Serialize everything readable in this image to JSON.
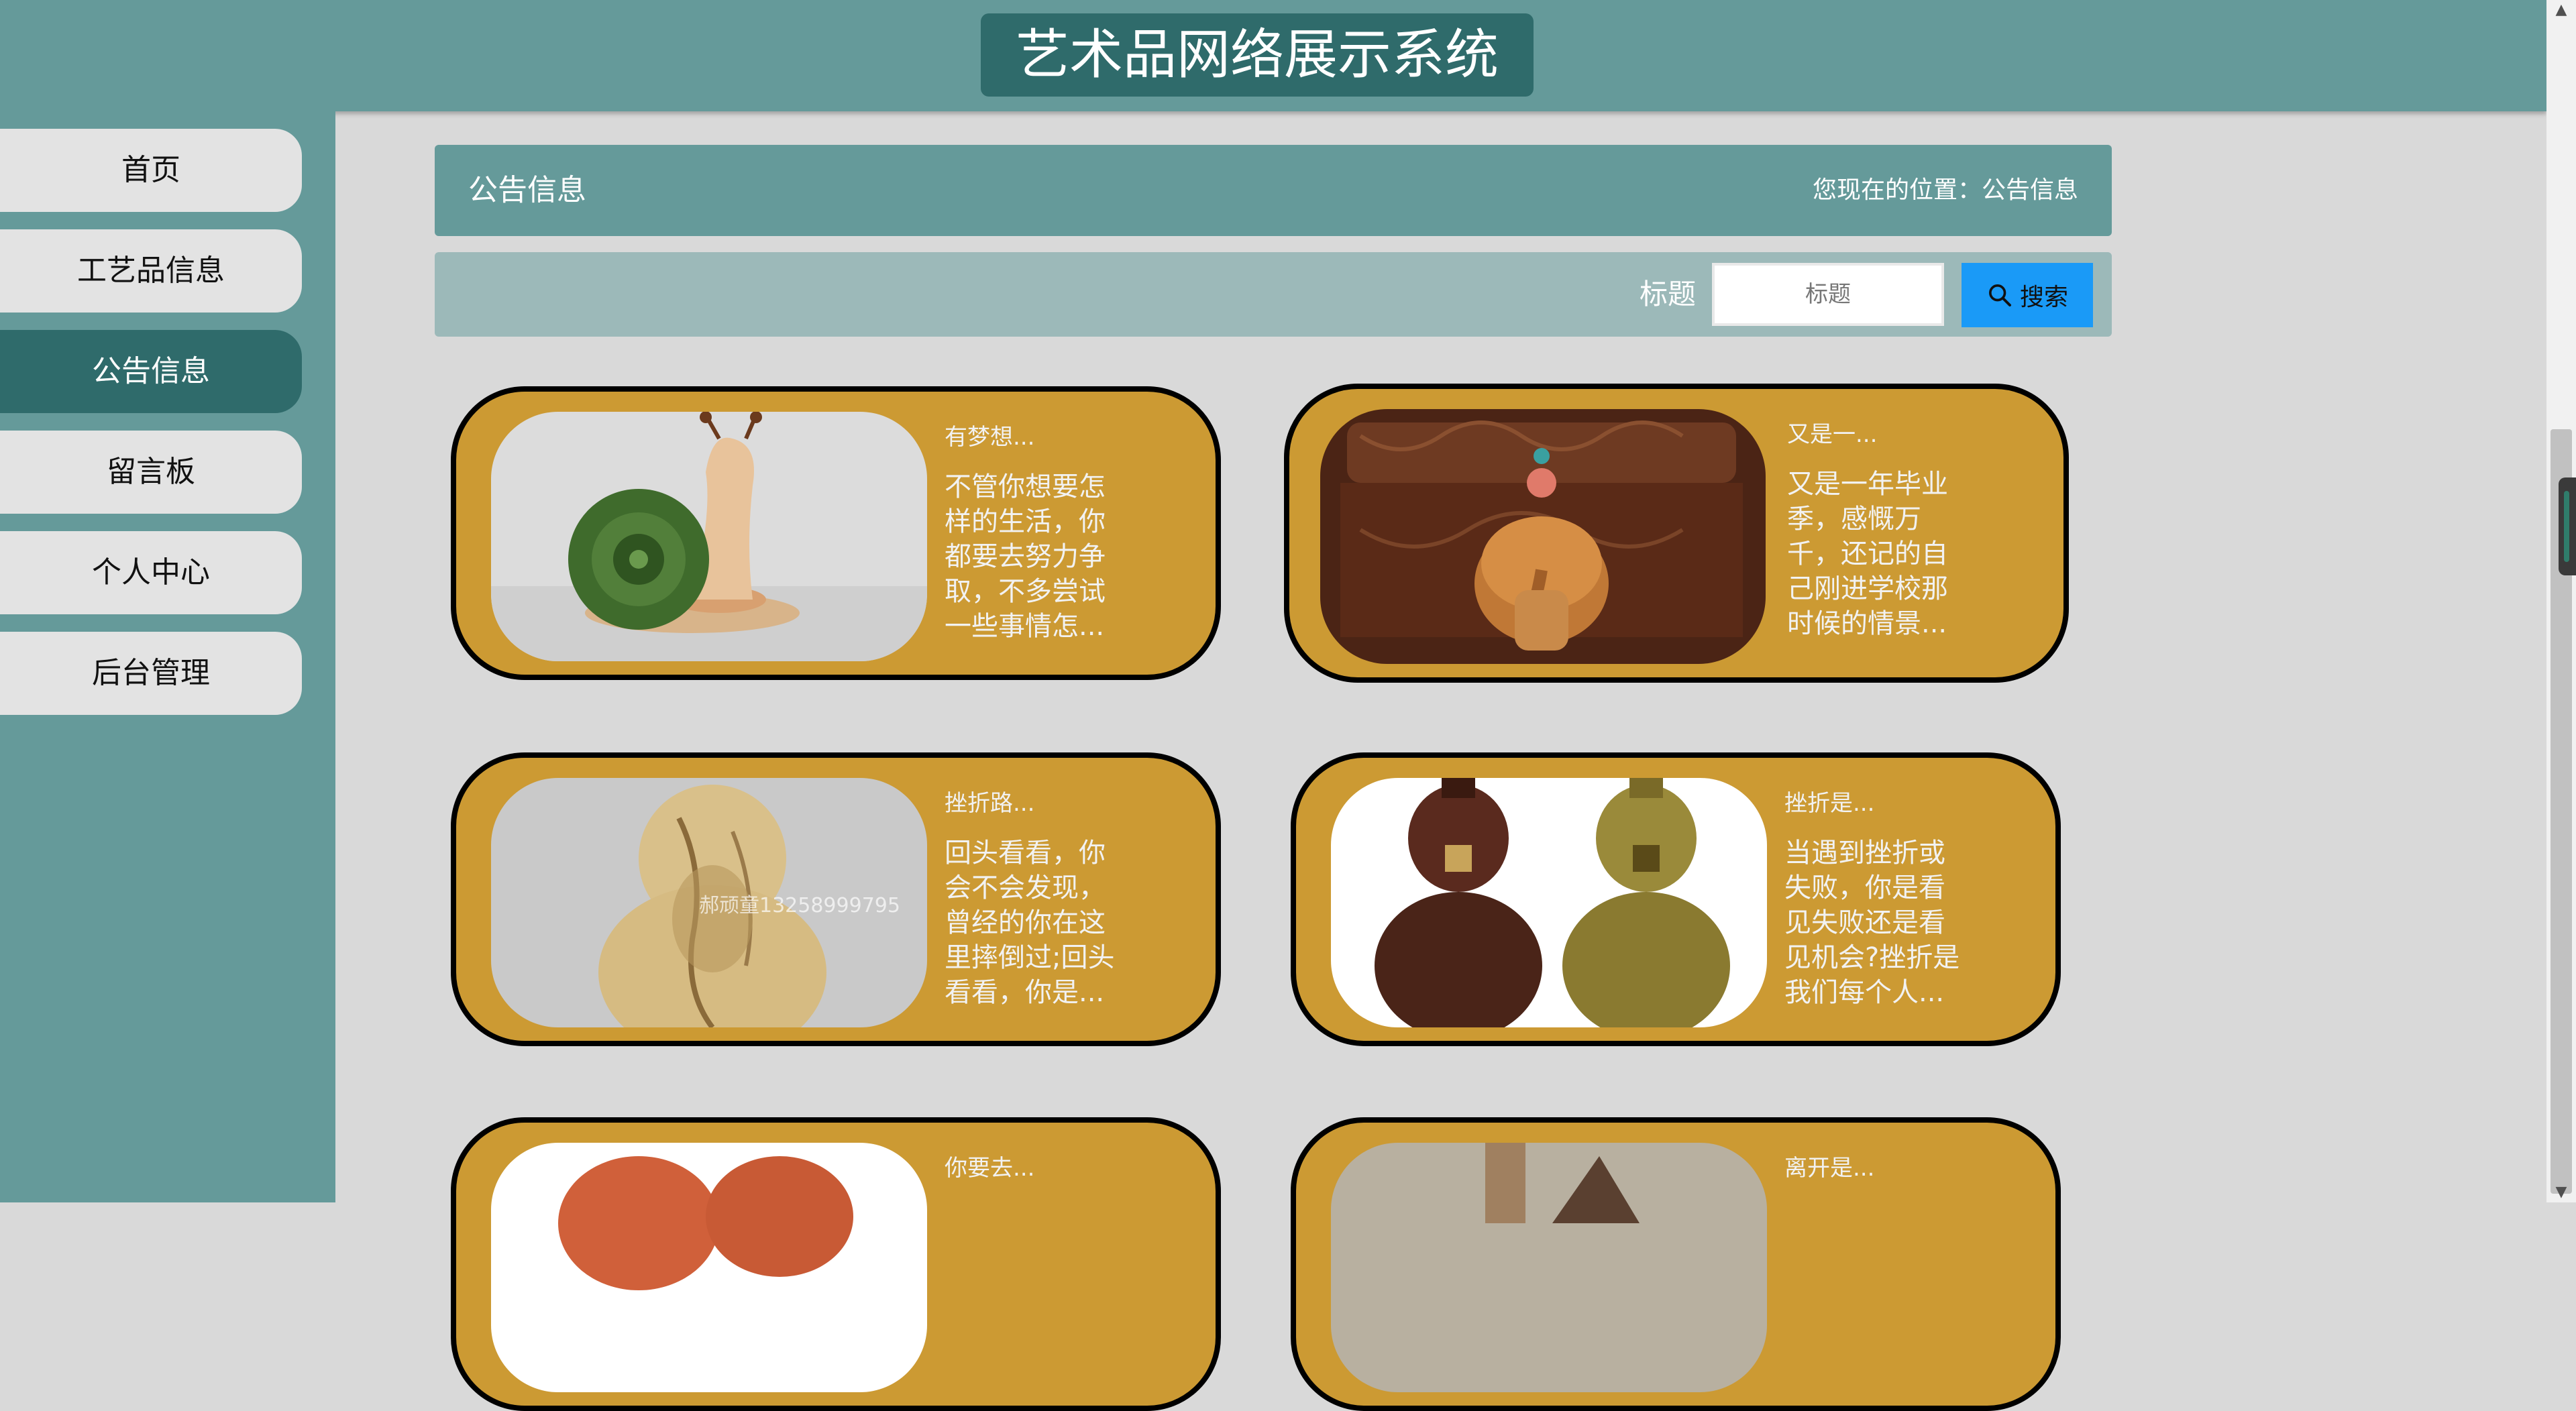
{
  "header": {
    "title": "艺术品网络展示系统"
  },
  "sidebar": {
    "items": [
      {
        "label": "首页"
      },
      {
        "label": "工艺品信息"
      },
      {
        "label": "公告信息"
      },
      {
        "label": "留言板"
      },
      {
        "label": "个人中心"
      },
      {
        "label": "后台管理"
      }
    ],
    "active_index": 2
  },
  "breadcrumb": {
    "title": "公告信息",
    "location": "您现在的位置：公告信息"
  },
  "search": {
    "label": "标题",
    "placeholder": "标题",
    "button_label": "搜索",
    "button_icon": "search-icon"
  },
  "cards": [
    {
      "title": "有梦想...",
      "body": "不管你想要怎样的生活，你都要去努力争取，不多尝试一些事情怎...",
      "image": "snail-figurine"
    },
    {
      "title": "又是一...",
      "body": "又是一年毕业季，感慨万千，还记的自己刚进学校那时候的情景...",
      "image": "elephant-carving"
    },
    {
      "title": "挫折路...",
      "body": "回头看看，你会不会发现，曾经的你在这里摔倒过;回头看看，你是...",
      "image": "gourd-painting",
      "watermark": "郝顽童13258999795"
    },
    {
      "title": "挫折是...",
      "body": "当遇到挫折或失败，你是看见失败还是看见机会?挫折是我们每个人...",
      "image": "twin-gourd-vases"
    },
    {
      "title": "你要去...",
      "body": "",
      "image": "red-carving"
    },
    {
      "title": "离开是...",
      "body": "",
      "image": "wooden-craft"
    }
  ],
  "colors": {
    "teal": "#659a9a",
    "dark_teal": "#2f6b6b",
    "card_gold": "#cc9a33",
    "search_blue": "#1a9af7",
    "background": "#d9d9d9"
  }
}
